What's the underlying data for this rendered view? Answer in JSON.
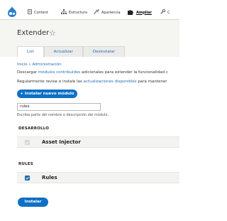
{
  "toolbar": {
    "items": [
      {
        "label": "Content",
        "icon": "page-icon"
      },
      {
        "label": "Estructura",
        "icon": "sitemap-icon"
      },
      {
        "label": "Apariencia",
        "icon": "wrench-brush-icon"
      },
      {
        "label": "Ampliar",
        "icon": "puzzle-icon",
        "active": true
      },
      {
        "label": "C",
        "icon": "wrench-icon"
      }
    ]
  },
  "header": {
    "title": "Extender",
    "tabs": [
      {
        "label": "List",
        "active": true
      },
      {
        "label": "Actualizar"
      },
      {
        "label": "Desinstalar"
      }
    ]
  },
  "breadcrumb": {
    "home": "Inicio",
    "separator": "»",
    "current": "Administración"
  },
  "description": {
    "line1_pre": "Descargar ",
    "line1_link": "módulos contribuidos",
    "line1_post": " adicionales para extender la funcionalidad c",
    "line2_pre": "Regularmente revise e instale las ",
    "line2_link": "actualizaciones disponibles",
    "line2_post": " para mantener"
  },
  "install_new_button": "+ Instalar nuevo módulo",
  "filter": {
    "value": "rules",
    "hint": "Escriba parte del nombre o descripción del módulo."
  },
  "sections": [
    {
      "title": "DESARROLLO",
      "module": "Asset Injector",
      "state": "disabled"
    },
    {
      "title": "RULES",
      "module": "Rules",
      "state": "checked"
    }
  ],
  "install_button": "Instalar",
  "colors": {
    "accent": "#0f70c5",
    "link": "#1e6db4"
  }
}
